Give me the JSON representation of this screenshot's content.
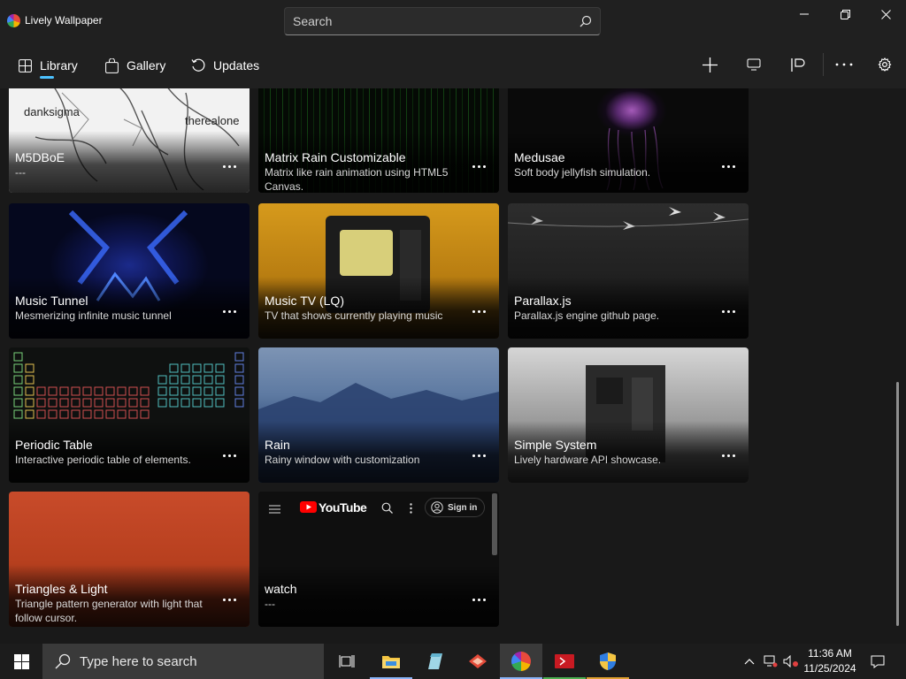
{
  "window": {
    "app_title": "Lively Wallpaper",
    "search_placeholder": "Search"
  },
  "nav": {
    "library": "Library",
    "gallery": "Gallery",
    "updates": "Updates"
  },
  "cards": [
    {
      "title": "M5DBoE",
      "desc": "---",
      "thumb_text_a": "danksigma",
      "thumb_text_b": "therealone"
    },
    {
      "title": "Matrix Rain Customizable",
      "desc": "Matrix like rain animation using HTML5 Canvas."
    },
    {
      "title": "Medusae",
      "desc": "Soft body jellyfish simulation."
    },
    {
      "title": "Music Tunnel",
      "desc": "Mesmerizing infinite music tunnel"
    },
    {
      "title": "Music TV (LQ)",
      "desc": "TV that shows currently playing music"
    },
    {
      "title": "Parallax.js",
      "desc": "Parallax.js engine github page."
    },
    {
      "title": "Periodic Table",
      "desc": "Interactive periodic table of elements."
    },
    {
      "title": "Rain",
      "desc": "Rainy window with customization"
    },
    {
      "title": "Simple System",
      "desc": "Lively hardware API showcase."
    },
    {
      "title": "Triangles & Light",
      "desc": "Triangle pattern generator with light that follow cursor."
    },
    {
      "title": "watch",
      "desc": "---",
      "yt_brand": "YouTube",
      "yt_signin": "Sign in"
    }
  ],
  "taskbar": {
    "search_placeholder": "Type here to search",
    "time": "11:36 AM",
    "date": "11/25/2024"
  },
  "colors": {
    "accent": "#4cc2ff",
    "youtube_red": "#ff0000"
  }
}
